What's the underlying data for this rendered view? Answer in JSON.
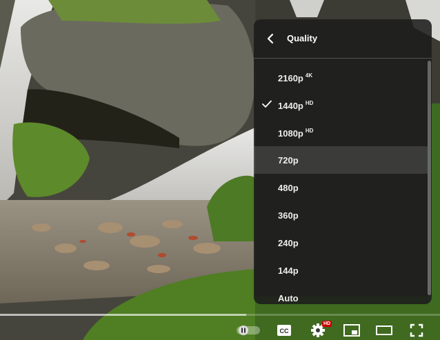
{
  "menu": {
    "title": "Quality",
    "items": [
      {
        "label": "2160p",
        "badge": "4K",
        "selected": false
      },
      {
        "label": "1440p",
        "badge": "HD",
        "selected": true
      },
      {
        "label": "1080p",
        "badge": "HD",
        "selected": false
      },
      {
        "label": "720p",
        "badge": "",
        "selected": false
      },
      {
        "label": "480p",
        "badge": "",
        "selected": false
      },
      {
        "label": "360p",
        "badge": "",
        "selected": false
      },
      {
        "label": "240p",
        "badge": "",
        "selected": false
      },
      {
        "label": "144p",
        "badge": "",
        "selected": false
      },
      {
        "label": "Auto",
        "badge": "",
        "selected": false
      }
    ]
  },
  "player": {
    "settings_badge": "HD",
    "progress_fraction": 0.56,
    "autoplay_state": "paused",
    "icons": [
      "back-arrow-icon",
      "checkmark-icon",
      "autoplay-toggle-icon",
      "subtitles-icon",
      "settings-gear-icon",
      "miniplayer-icon",
      "theater-mode-icon",
      "fullscreen-icon"
    ]
  },
  "colors": {
    "menu_bg": "#1c1c1c",
    "badge_red": "#cc0000",
    "text": "#eeeeee"
  }
}
